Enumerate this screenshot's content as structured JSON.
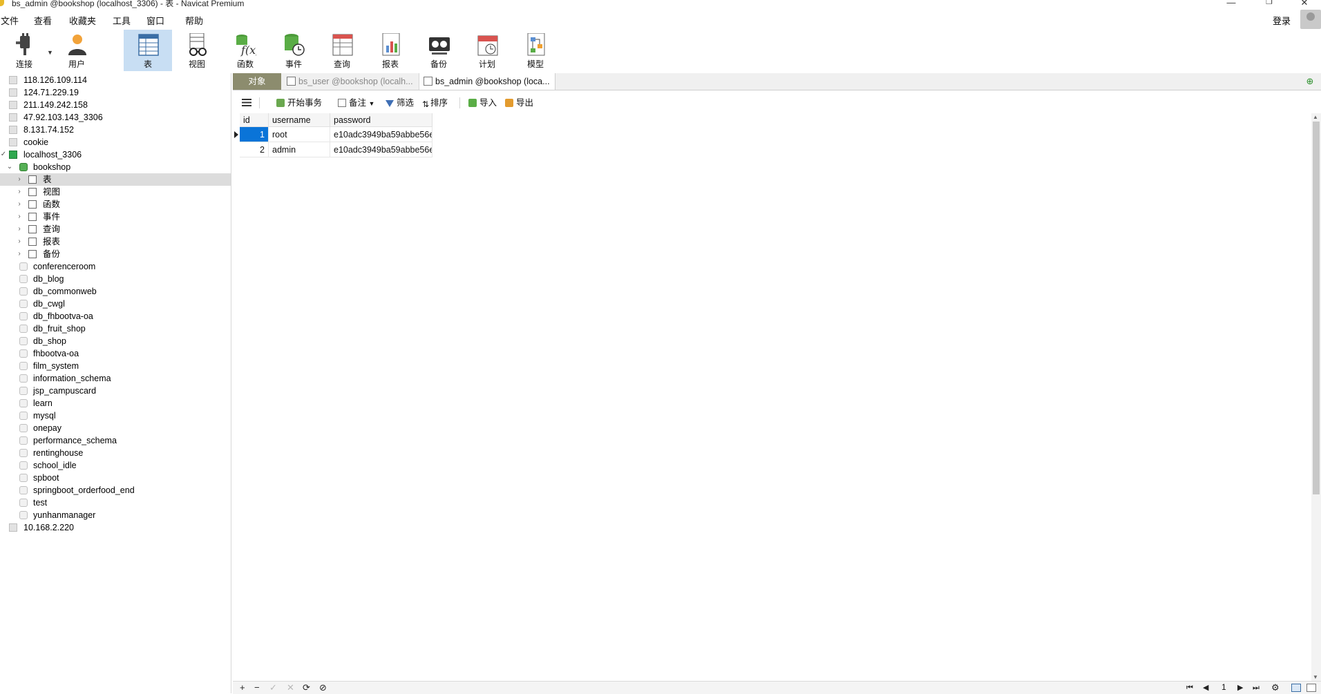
{
  "window": {
    "title": "bs_admin @bookshop (localhost_3306) - 表 - Navicat Premium",
    "minimize": "—",
    "maximize": "❐",
    "close": "✕"
  },
  "menu": [
    "文件",
    "查看",
    "收藏夹",
    "工具",
    "窗口",
    "帮助"
  ],
  "login_label": "登录",
  "toolbar": [
    {
      "label": "连接",
      "icon": "plug-icon"
    },
    {
      "label": "用户",
      "icon": "user-icon"
    },
    {
      "label": "表",
      "icon": "table-icon",
      "active": true
    },
    {
      "label": "视图",
      "icon": "view-icon"
    },
    {
      "label": "函数",
      "icon": "function-icon"
    },
    {
      "label": "事件",
      "icon": "event-icon"
    },
    {
      "label": "查询",
      "icon": "query-icon"
    },
    {
      "label": "报表",
      "icon": "report-icon"
    },
    {
      "label": "备份",
      "icon": "backup-icon"
    },
    {
      "label": "计划",
      "icon": "calendar-icon"
    },
    {
      "label": "模型",
      "icon": "model-icon"
    }
  ],
  "tree": {
    "connections_top": [
      "118.126.109.114",
      "124.71.229.19",
      "211.149.242.158",
      "47.92.103.143_3306",
      "8.131.74.152",
      "cookie"
    ],
    "active_connection": "localhost_3306",
    "active_database": "bookshop",
    "object_nodes": [
      "表",
      "视图",
      "函数",
      "事件",
      "查询",
      "报表",
      "备份"
    ],
    "databases": [
      "conferenceroom",
      "db_blog",
      "db_commonweb",
      "db_cwgl",
      "db_fhbootva-oa",
      "db_fruit_shop",
      "db_shop",
      "fhbootva-oa",
      "film_system",
      "information_schema",
      "jsp_campuscard",
      "learn",
      "mysql",
      "onepay",
      "performance_schema",
      "rentinghouse",
      "school_idle",
      "spboot",
      "springboot_orderfood_end",
      "test",
      "yunhanmanager"
    ],
    "connections_bottom": [
      "10.168.2.220"
    ]
  },
  "tabs": {
    "objects": "对象",
    "tab1": "bs_user @bookshop (localh...",
    "tab2": "bs_admin @bookshop (loca..."
  },
  "table_toolbar": {
    "begin_transaction": "开始事务",
    "memo": "备注",
    "filter": "筛选",
    "sort": "排序",
    "import": "导入",
    "export": "导出"
  },
  "grid": {
    "columns": [
      "id",
      "username",
      "password"
    ],
    "rows": [
      [
        "1",
        "root",
        "e10adc3949ba59abbe56e"
      ],
      [
        "2",
        "admin",
        "e10adc3949ba59abbe56e"
      ]
    ]
  },
  "bottom": {
    "add": "+",
    "remove": "−",
    "apply": "✓",
    "discard": "✕",
    "refresh": "⟳",
    "stop": "⊘",
    "first": "⏮",
    "prev": "◀",
    "page": "1",
    "next": "▶",
    "last": "⏭",
    "settings": "⚙"
  },
  "colors": {
    "selection": "#0a74d8",
    "objects_tab": "#8c8c6e",
    "toolbar_active": "#c8def3"
  }
}
